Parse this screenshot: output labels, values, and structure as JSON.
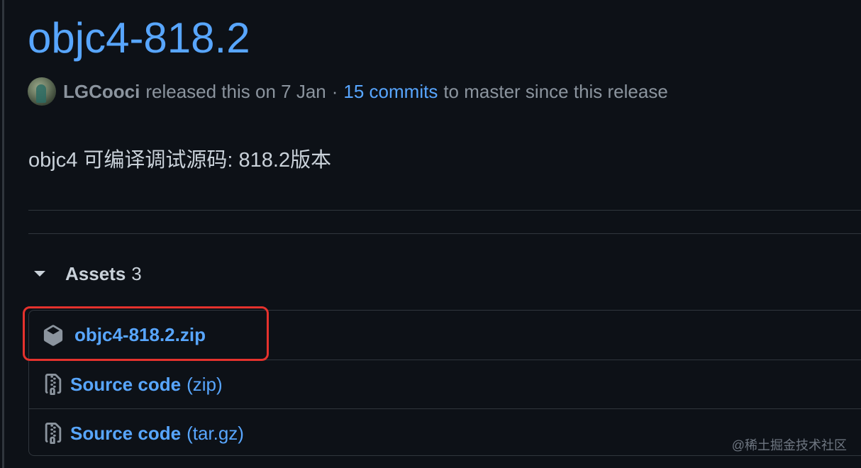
{
  "release": {
    "title": "objc4-818.2",
    "author": "LGCooci",
    "released_text": "released this on 7 Jan",
    "separator": "·",
    "commits_link": "15 commits",
    "commits_tail": "to master since this release",
    "description": "objc4 可编译调试源码: 818.2版本"
  },
  "assets": {
    "label": "Assets",
    "count": "3",
    "items": [
      {
        "name": "objc4-818.2.zip",
        "ext": "",
        "icon": "package-icon",
        "highlighted": true
      },
      {
        "name": "Source code",
        "ext": "(zip)",
        "icon": "file-zip-icon",
        "highlighted": false
      },
      {
        "name": "Source code",
        "ext": "(tar.gz)",
        "icon": "file-zip-icon",
        "highlighted": false
      }
    ]
  },
  "watermark": "@稀土掘金技术社区",
  "colors": {
    "background": "#0d1117",
    "link": "#58a6ff",
    "muted": "#8b949e",
    "text": "#c9d1d9",
    "border": "#30363d",
    "highlight": "#e5322d"
  }
}
